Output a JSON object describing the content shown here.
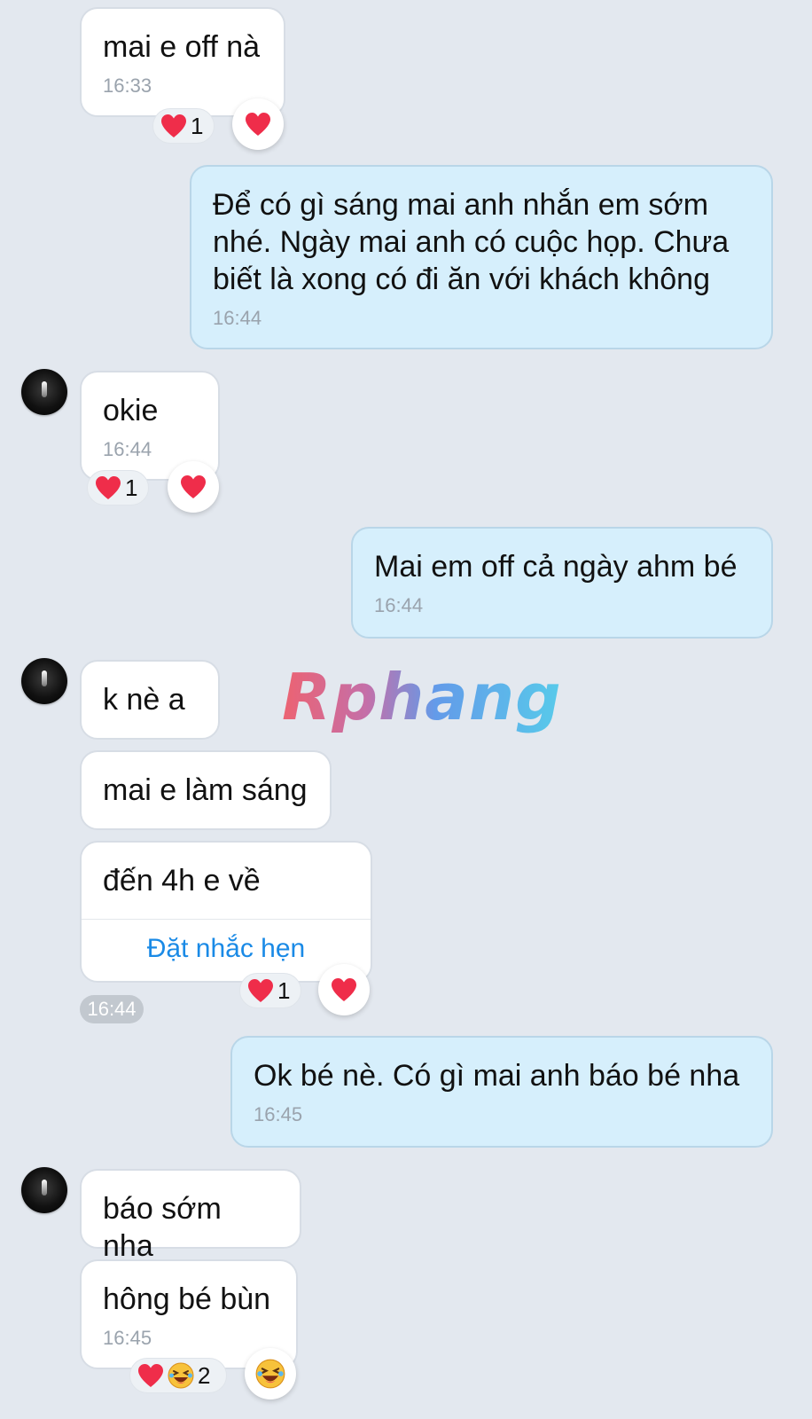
{
  "messages": [
    {
      "text": "mai e off nà",
      "time": "16:33",
      "reaction_count": "1"
    },
    {
      "text": "Để có gì sáng mai anh nhắn em sớm nhé. Ngày mai anh có cuộc họp. Chưa biết là xong có đi ăn với khách không",
      "time": "16:44"
    },
    {
      "text": "okie",
      "time": "16:44",
      "reaction_count": "1"
    },
    {
      "text": "Mai em off cả ngày ahm bé",
      "time": "16:44"
    },
    {
      "text": "k nè a"
    },
    {
      "text": "mai e làm sáng"
    },
    {
      "text": "đến 4h e về",
      "action": "Đặt nhắc hẹn",
      "time": "16:44",
      "reaction_count": "1"
    },
    {
      "text": "Ok bé nè. Có gì mai anh báo bé nha",
      "time": "16:45"
    },
    {
      "text": "báo sớm nha"
    },
    {
      "text": "hông bé bùn",
      "time": "16:45",
      "reaction_count": "2"
    }
  ],
  "watermark": "Rphang",
  "colors": {
    "background": "#e3e8ef",
    "incoming_bubble": "#ffffff",
    "outgoing_bubble": "#d6effc",
    "link": "#1a8ae6",
    "heart": "#ef2d4a"
  },
  "icons": [
    "avatar",
    "heart-icon",
    "laughing-emoji-icon"
  ]
}
